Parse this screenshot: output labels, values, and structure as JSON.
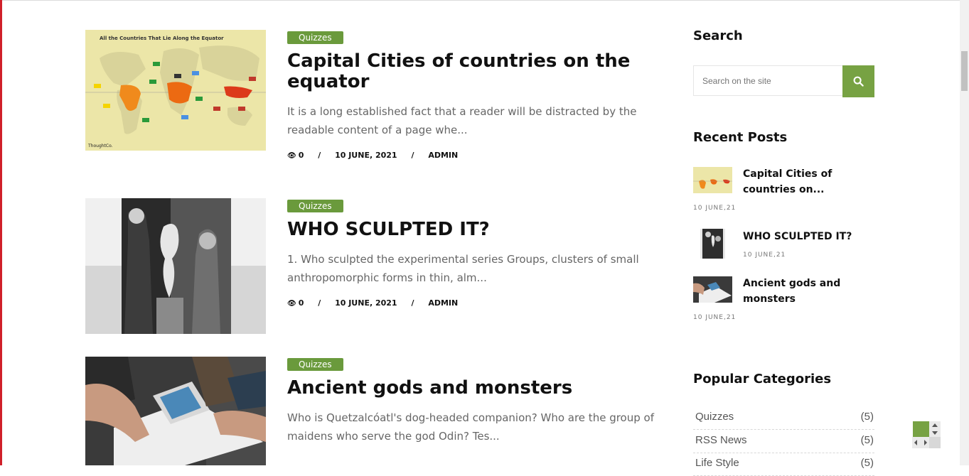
{
  "posts": [
    {
      "category": "Quizzes",
      "title": "Capital Cities of countries on the equator",
      "excerpt": "It is a long established fact that a reader will be distracted by the readable content of a page whe...",
      "views": "0",
      "date": "10 JUNE, 2021",
      "author": "ADMIN",
      "image_caption": "All the Countries That Lie Along the Equator",
      "image_credit": "ThoughtCo."
    },
    {
      "category": "Quizzes",
      "title": "WHO SCULPTED IT?",
      "excerpt": "1. Who sculpted the experimental series Groups, clusters of small anthropomorphic forms in thin, alm...",
      "views": "0",
      "date": "10 JUNE, 2021",
      "author": "ADMIN"
    },
    {
      "category": "Quizzes",
      "title": "Ancient gods and monsters",
      "excerpt": "Who is Quetzalcóatl's dog-headed companion? Who are the group of maidens who serve the god Odin? Tes..."
    }
  ],
  "meta_separator": "/",
  "sidebar": {
    "search": {
      "heading": "Search",
      "placeholder": "Search on the site",
      "button_icon": "search-icon"
    },
    "recent": {
      "heading": "Recent Posts",
      "items": [
        {
          "title": "Capital Cities of countries on...",
          "date": "10 JUNE,21"
        },
        {
          "title": "WHO SCULPTED IT?",
          "date": "10 JUNE,21"
        },
        {
          "title": "Ancient gods and monsters",
          "date": "10 JUNE,21"
        }
      ]
    },
    "categories": {
      "heading": "Popular Categories",
      "items": [
        {
          "name": "Quizzes",
          "count": "(5)"
        },
        {
          "name": "RSS News",
          "count": "(5)"
        },
        {
          "name": "Life Style",
          "count": "(5)"
        }
      ]
    }
  },
  "colors": {
    "accent_green": "#6a9a3c",
    "button_green": "#77a243",
    "left_bar": "#d0202a"
  }
}
